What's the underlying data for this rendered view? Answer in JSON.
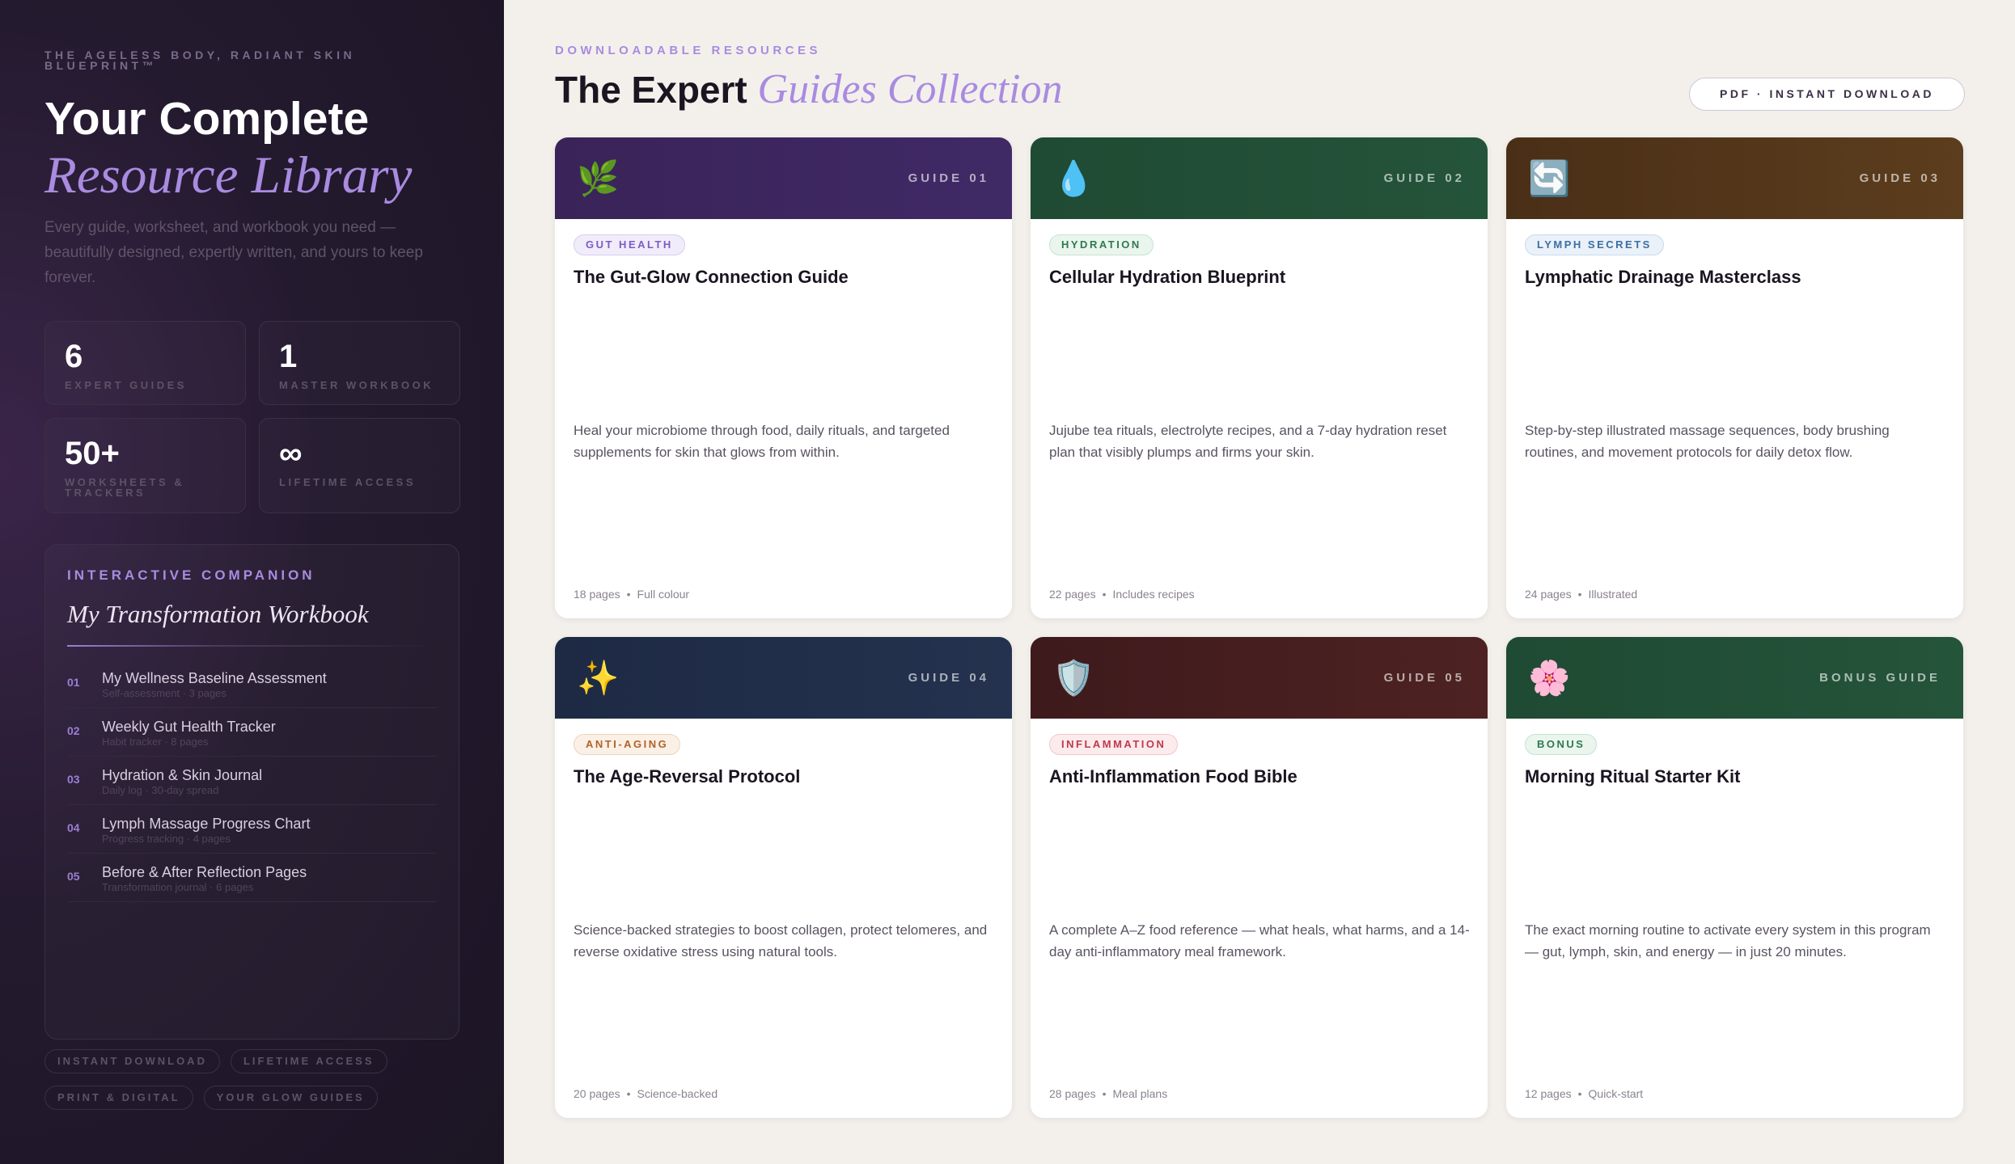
{
  "sidebar": {
    "brand": "THE AGELESS BODY, RADIANT SKIN BLUEPRINT™",
    "title_line1": "Your Complete",
    "title_line2": "Resource Library",
    "description": "Every guide, worksheet, and workbook you need — beautifully designed, expertly written, and yours to keep forever.",
    "stats": [
      {
        "value": "6",
        "label": "EXPERT GUIDES"
      },
      {
        "value": "1",
        "label": "MASTER WORKBOOK"
      },
      {
        "value": "50+",
        "label": "WORKSHEETS & TRACKERS"
      },
      {
        "value": "∞",
        "label": "LIFETIME ACCESS"
      }
    ],
    "workbook": {
      "kicker": "INTERACTIVE COMPANION",
      "title": "My Transformation Workbook",
      "items": [
        {
          "num": "01",
          "name": "My Wellness Baseline Assessment",
          "sub": "Self-assessment · 3 pages"
        },
        {
          "num": "02",
          "name": "Weekly Gut Health Tracker",
          "sub": "Habit tracker · 8 pages"
        },
        {
          "num": "03",
          "name": "Hydration & Skin Journal",
          "sub": "Daily log · 30-day spread"
        },
        {
          "num": "04",
          "name": "Lymph Massage Progress Chart",
          "sub": "Progress tracking · 4 pages"
        },
        {
          "num": "05",
          "name": "Before & After Reflection Pages",
          "sub": "Transformation journal · 6 pages"
        }
      ]
    },
    "tags": [
      "INSTANT DOWNLOAD",
      "LIFETIME ACCESS",
      "PRINT & DIGITAL",
      "YOUR GLOW GUIDES"
    ]
  },
  "main": {
    "kicker": "DOWNLOADABLE RESOURCES",
    "title_plain": "The Expert",
    "title_accent": "Guides Collection",
    "pdf_pill": "PDF · INSTANT DOWNLOAD",
    "cards": [
      {
        "icon": "🌿",
        "icon_name": "leaf-icon",
        "guide": "GUIDE 01",
        "badge": "GUT HEALTH",
        "title": "The Gut-Glow Connection Guide",
        "desc": "Heal your microbiome through food, daily rituals, and targeted supplements for skin that glows from within.",
        "pages": "18 pages",
        "meta": "Full colour",
        "head_color": "#3a2358",
        "head_color2": "#402a66",
        "badge_color": "#7c5cc4",
        "badge_bg": "#f1ecfa",
        "badge_border": "#d9ccf0"
      },
      {
        "icon": "💧",
        "icon_name": "water-drop-icon",
        "guide": "GUIDE 02",
        "badge": "HYDRATION",
        "title": "Cellular Hydration Blueprint",
        "desc": "Jujube tea rituals, electrolyte recipes, and a 7-day hydration reset plan that visibly plumps and firms your skin.",
        "pages": "22 pages",
        "meta": "Includes recipes",
        "head_color": "#1f4a33",
        "head_color2": "#24543a",
        "badge_color": "#2f7a4c",
        "badge_bg": "#eaf5ee",
        "badge_border": "#c6e3d0"
      },
      {
        "icon": "🔄",
        "icon_name": "cycle-arrows-icon",
        "guide": "GUIDE 03",
        "badge": "LYMPH SECRETS",
        "title": "Lymphatic Drainage Masterclass",
        "desc": "Step-by-step illustrated massage sequences, body brushing routines, and movement protocols for daily detox flow.",
        "pages": "24 pages",
        "meta": "Illustrated",
        "head_color": "#4a2f17",
        "head_color2": "#5c3d1d",
        "badge_color": "#3b6fa3",
        "badge_bg": "#eaf1f9",
        "badge_border": "#c8daed"
      },
      {
        "icon": "✨",
        "icon_name": "sparkles-icon",
        "guide": "GUIDE 04",
        "badge": "ANTI-AGING",
        "title": "The Age-Reversal Protocol",
        "desc": "Science-backed strategies to boost collagen, protect telomeres, and reverse oxidative stress using natural tools.",
        "pages": "20 pages",
        "meta": "Science-backed",
        "head_color": "#1e2a44",
        "head_color2": "#24324f",
        "badge_color": "#b0632a",
        "badge_bg": "#fbf0e6",
        "badge_border": "#efd2b8"
      },
      {
        "icon": "🛡️",
        "icon_name": "shield-icon",
        "guide": "GUIDE 05",
        "badge": "INFLAMMATION",
        "title": "Anti-Inflammation Food Bible",
        "desc": "A complete A–Z food reference — what heals, what harms, and a 14-day anti-inflammatory meal framework.",
        "pages": "28 pages",
        "meta": "Meal plans",
        "head_color": "#3e1a1c",
        "head_color2": "#4e2222",
        "badge_color": "#c0394a",
        "badge_bg": "#fcebed",
        "badge_border": "#f1c6cc"
      },
      {
        "icon": "🌸",
        "icon_name": "blossom-icon",
        "guide": "BONUS GUIDE",
        "badge": "BONUS",
        "title": "Morning Ritual Starter Kit",
        "desc": "The exact morning routine to activate every system in this program — gut, lymph, skin, and energy — in just 20 minutes.",
        "pages": "12 pages",
        "meta": "Quick-start",
        "head_color": "#1f4a33",
        "head_color2": "#24543a",
        "badge_color": "#2f7a4c",
        "badge_bg": "#eaf5ee",
        "badge_border": "#c6e3d0"
      }
    ]
  }
}
